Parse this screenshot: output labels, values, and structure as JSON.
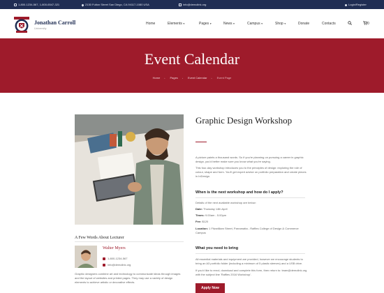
{
  "topbar": {
    "phone": "1-800-1234-567, 1-800-6547-321",
    "address": "2130 Fulton Street San Diego, CA 94117-1080 USA",
    "email": "info@demolink.org",
    "login": "Login/Register"
  },
  "brand": {
    "name": "Jonathan Carroll",
    "subtitle": "University"
  },
  "nav": {
    "items": [
      {
        "label": "Home",
        "dropdown": false
      },
      {
        "label": "Elements",
        "dropdown": true
      },
      {
        "label": "Pages",
        "dropdown": true
      },
      {
        "label": "News",
        "dropdown": true
      },
      {
        "label": "Campus",
        "dropdown": true
      },
      {
        "label": "Shop",
        "dropdown": true
      },
      {
        "label": "Donate",
        "dropdown": false
      },
      {
        "label": "Contacts",
        "dropdown": false
      }
    ],
    "cart_count": "0"
  },
  "banner": {
    "title": "Event Calendar",
    "breadcrumbs": [
      "Home",
      "Pages",
      "Event Calendar",
      "Event Page"
    ]
  },
  "event": {
    "title": "Graphic Design Workshop",
    "intro_1": "A picture paints a thousand words. So if you're planning on pursuing a career in graphic design, you'd better make sure you know what you're saying.",
    "intro_2": "This four-day workshop introduces you to the principles of design: exploring the role of colour, shape and form. You'll get expert advice on portfolio preparation and create pieces in InDesign.",
    "next_heading": "When is the next workshop and how do I apply?",
    "details_intro": "Details of the next available workshop are below:",
    "date_label": "Date:",
    "date_value": "Thursday 14th April",
    "times_label": "Times:",
    "times_value": "9.00am - 5.00pm",
    "fee_label": "Fee:",
    "fee_value": "$120",
    "location_label": "Location:",
    "location_value": "1 Fitzwilliam Street, Parramatta - Raffles College of Design & Commerce Campus",
    "bring_heading": "What you need to bring",
    "bring_1": "All essential materials and equipment are provided, however we encourage students to bring an A3 portfolio folder (including a minimum of 5 plastic sleeves) and a USB drive.",
    "bring_2": "If you'd like to enrol, download and complete this form, then return to: team@demolink.org with the subject line 'Raffles 2016 Workshop'.",
    "apply_label": "Apply Now"
  },
  "lecturer": {
    "heading": "A Few Words About Lecturer",
    "name": "Walter Myers",
    "phone": "1-800-1234-567",
    "email": "info@demolink.org",
    "bio": "Graphic designers combine art and technology to communicate ideas through images and the layout of websites and printed pages. They may use a variety of design elements to achieve artistic or decorative effects."
  },
  "colors": {
    "topbar": "#1f2d53",
    "accent": "#9e1b2b"
  }
}
